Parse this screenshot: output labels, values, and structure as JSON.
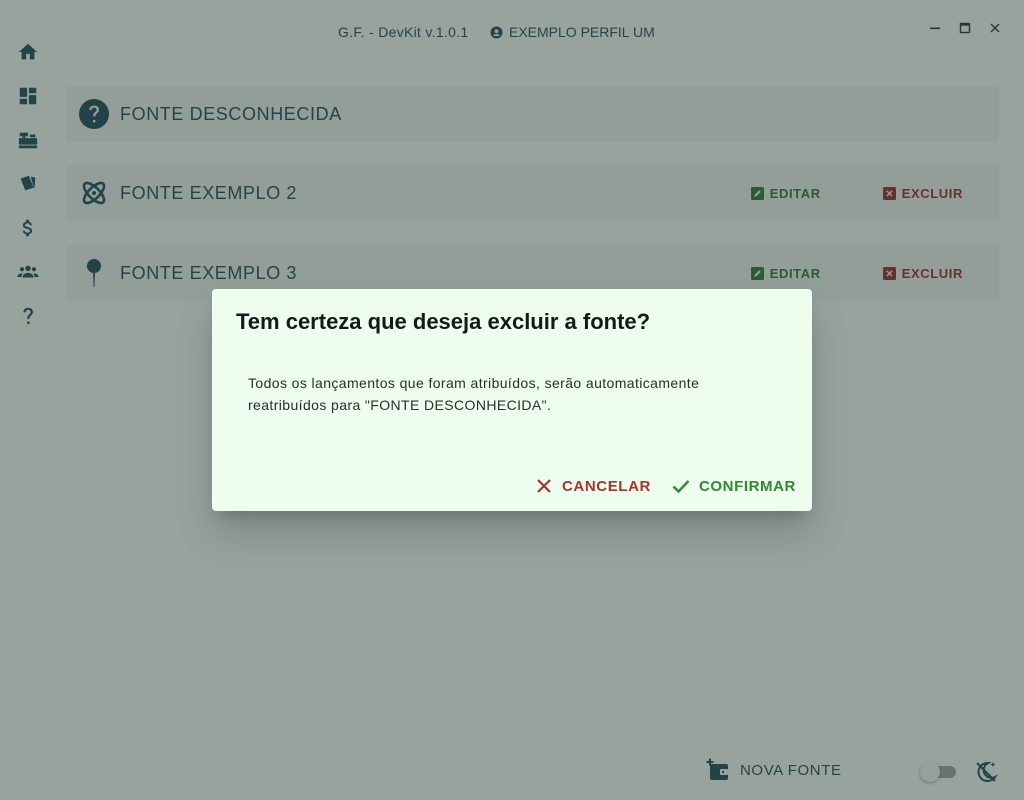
{
  "window": {
    "title": "G.F. - DevKit v.1.0.1",
    "profile_name": "EXEMPLO PERFIL UM",
    "controls": [
      "minimize-icon",
      "maximize-icon",
      "close-icon"
    ]
  },
  "sidebar": {
    "items": [
      {
        "icon": "home-icon"
      },
      {
        "icon": "dashboard-icon"
      },
      {
        "icon": "cash-register-icon"
      },
      {
        "icon": "cards-icon"
      },
      {
        "icon": "dollar-icon"
      },
      {
        "icon": "people-icon"
      },
      {
        "icon": "help-icon"
      }
    ]
  },
  "sources": [
    {
      "title": "FONTE DESCONHECIDA",
      "icon": "question-circle-icon"
    },
    {
      "title": "FONTE EXEMPLO 2",
      "icon": "atom-icon",
      "edit_label": "EDITAR",
      "delete_label": "EXCLUIR"
    },
    {
      "title": "FONTE EXEMPLO 3",
      "icon": "pin-icon",
      "edit_label": "EDITAR",
      "delete_label": "EXCLUIR"
    }
  ],
  "footer": {
    "new_source_label": "NOVA FONTE",
    "theme_toggle": {
      "on": false
    }
  },
  "dialog": {
    "title": "Tem certeza que deseja excluir a fonte?",
    "body_line1": "Todos os lançamentos que foram atribuídos, serão automaticamente",
    "body_line2": "reatribuídos para \"FONTE DESCONHECIDA\".",
    "cancel_label": "CANCELAR",
    "confirm_label": "CONFIRMAR"
  },
  "colors": {
    "primary": "#1e4e5a",
    "edit": "#2f7a2f",
    "delete": "#9a2c2c",
    "dialog_bg": "#edfdee"
  }
}
